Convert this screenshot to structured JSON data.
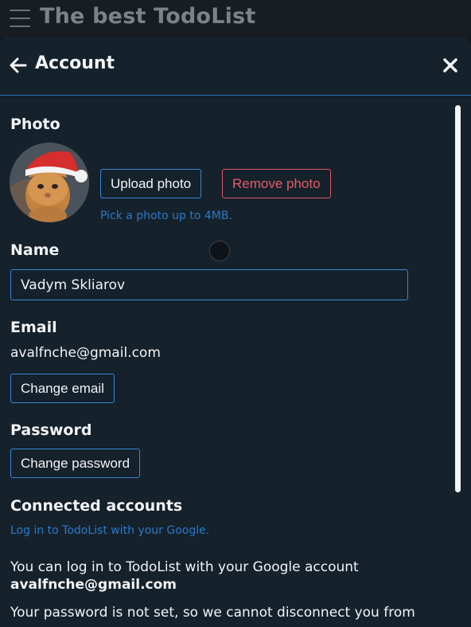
{
  "app": {
    "title": "The best TodoList"
  },
  "panel": {
    "title": "Account"
  },
  "photo": {
    "label": "Photo",
    "upload_label": "Upload photo",
    "remove_label": "Remove photo",
    "hint": "Pick a photo up to 4MB."
  },
  "name": {
    "label": "Name",
    "value": "Vadym Skliarov"
  },
  "email": {
    "label": "Email",
    "value": "avalfnche@gmail.com",
    "change_label": "Change email"
  },
  "password": {
    "label": "Password",
    "change_label": "Change password"
  },
  "connected": {
    "label": "Connected accounts",
    "link_text": "Log in to TodoList with your Google.",
    "info_line": "You can log in to TodoList with your Google account",
    "account_email": "avalfnche@gmail.com",
    "warning_line": "Your password is not set, so we cannot disconnect you from"
  },
  "colors": {
    "accent": "#3a86d6",
    "danger": "#e05667",
    "background": "#15212b"
  }
}
